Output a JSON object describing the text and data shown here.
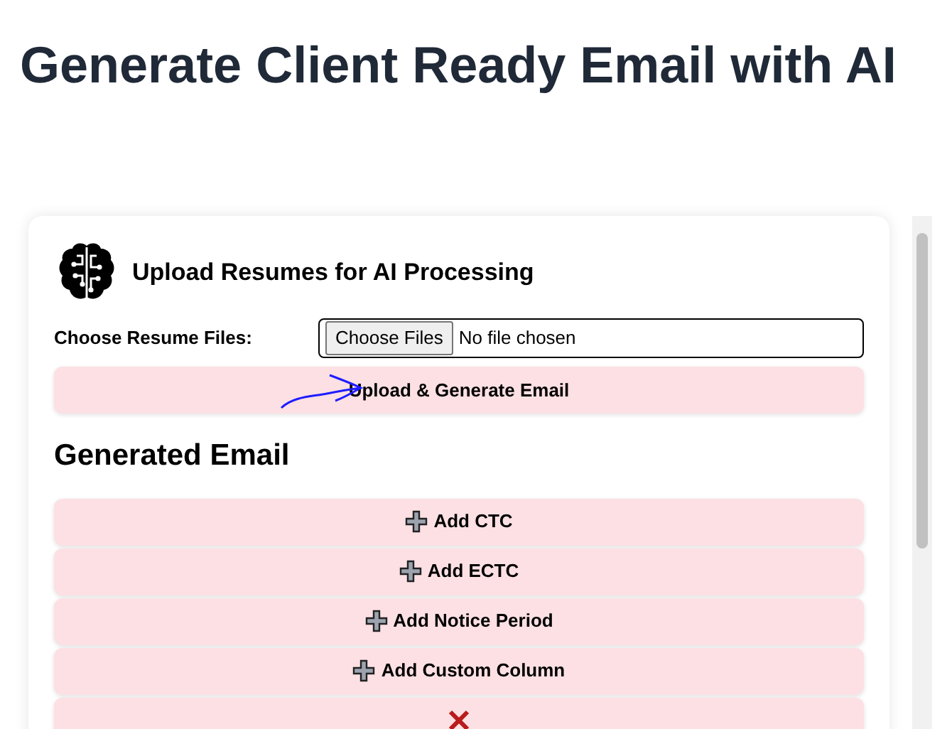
{
  "title": "Generate Client Ready Email with AI",
  "upload_card": {
    "heading": "Upload Resumes for AI Processing",
    "file_label": "Choose Resume Files:",
    "file_button": "Choose Files",
    "file_status": "No file chosen",
    "submit_button": "Upload & Generate Email"
  },
  "generated_email": {
    "heading": "Generated Email",
    "actions": [
      {
        "kind": "add",
        "label": "Add CTC"
      },
      {
        "kind": "add",
        "label": "Add ECTC"
      },
      {
        "kind": "add",
        "label": "Add Notice Period"
      },
      {
        "kind": "add",
        "label": "Add Custom Column"
      },
      {
        "kind": "remove"
      }
    ]
  }
}
